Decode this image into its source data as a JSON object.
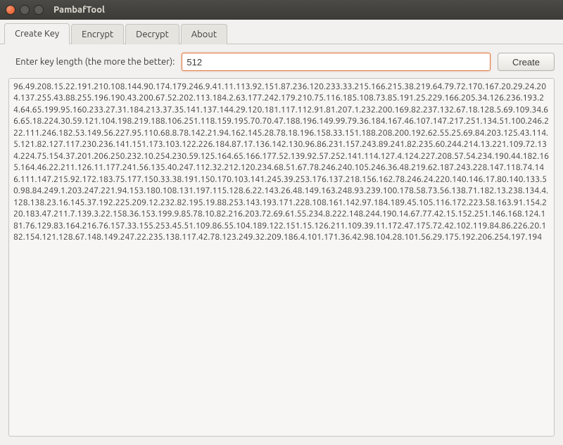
{
  "window": {
    "title": "PambafTool"
  },
  "tabs": {
    "create_key": "Create Key",
    "encrypt": "Encrypt",
    "decrypt": "Decrypt",
    "about": "About"
  },
  "form": {
    "label": "Enter key length (the more the better):",
    "key_length_value": "512",
    "create_button": "Create"
  },
  "output_key": "96.49.208.15.22.191.210.108.144.90.174.179.246.9.41.11.113.92.151.87.236.120.233.33.215.166.215.38.219.64.79.72.170.167.20.29.24.204.137.255.43.88.255.196.190.43.200.67.52.202.113.184.2.63.177.242.179.210.75.116.185.108.73.85.191.25.229.166.205.34.126.236.193.24.64.65.199.95.160.233.27.31.184.213.37.35.141.137.144.29.120.181.117.112.91.81.207.1.232.200.169.82.237.132.67.18.128.5.69.109.34.66.65.18.224.30.59.121.104.198.219.188.106.251.118.159.195.70.70.47.188.196.149.99.79.36.184.167.46.107.147.217.251.134.51.100.246.222.111.246.182.53.149.56.227.95.110.68.8.78.142.21.94.162.145.28.78.18.196.158.33.151.188.208.200.192.62.55.25.69.84.203.125.43.114.5.121.82.127.117.230.236.141.151.173.103.122.226.184.87.17.136.142.130.96.86.231.157.243.89.241.82.235.60.244.214.13.221.109.72.134.224.75.154.37.201.206.250.232.10.254.230.59.125.164.65.166.177.52.139.92.57.252.141.114.127.4.124.227.208.57.54.234.190.44.182.165.164.46.22.211.126.11.177.241.56.135.40.247.112.32.212.120.234.68.51.67.78.246.240.105.246.36.48.219.62.187.243.228.147.118.74.146.111.147.215.92.172.183.75.177.150.33.38.191.150.170.103.141.245.39.253.176.137.218.156.162.78.246.24.220.140.146.17.80.140.133.50.98.84.249.1.203.247.221.94.153.180.108.131.197.115.128.6.22.143.26.48.149.163.248.93.239.100.178.58.73.56.138.71.182.13.238.134.4.128.138.23.16.145.37.192.225.209.12.232.82.195.19.88.253.143.193.171.228.108.161.142.97.184.189.45.105.116.172.223.58.163.91.154.220.183.47.211.7.139.3.22.158.36.153.199.9.85.78.10.82.216.203.72.69.61.55.234.8.222.148.244.190.14.67.77.42.15.152.251.146.168.124.181.76.129.83.164.216.76.157.33.155.253.45.51.109.86.55.104.189.122.151.15.126.211.109.39.11.172.47.175.72.42.102.119.84.86.226.20.182.154.121.128.67.148.149.247.22.235.138.117.42.78.123.249.32.209.186.4.101.171.36.42.98.104.28.101.56.29.175.192.206.254.197.194"
}
